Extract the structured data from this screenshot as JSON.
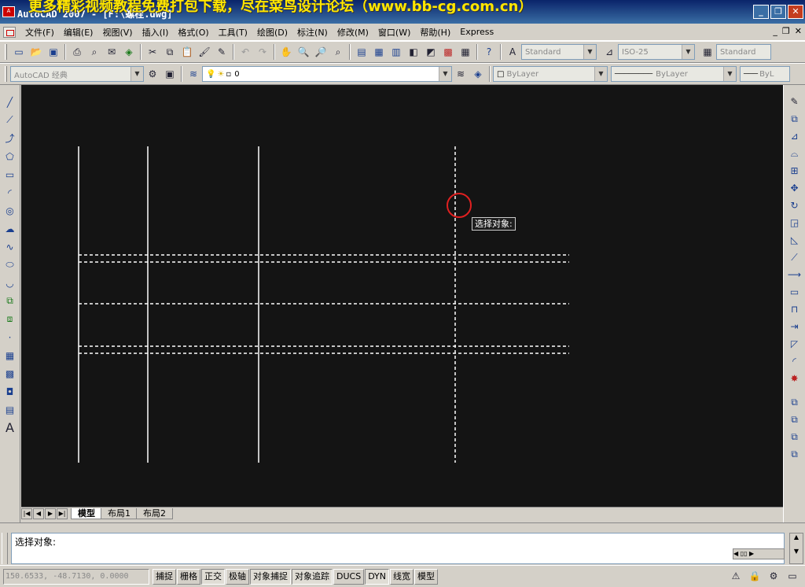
{
  "window": {
    "app_title": "AutoCAD 2007 - [F:\\螺栓.dwg]",
    "banner": "更多精彩视频教程免费打包下载，尽在菜鸟设计论坛（www.bb-cg.com.cn）",
    "app_icon": "A"
  },
  "menu": {
    "items": [
      "文件(F)",
      "编辑(E)",
      "视图(V)",
      "插入(I)",
      "格式(O)",
      "工具(T)",
      "绘图(D)",
      "标注(N)",
      "修改(M)",
      "窗口(W)",
      "帮助(H)",
      "Express"
    ]
  },
  "styles_toolbar": {
    "text_style": "Standard",
    "dim_style": "ISO-25",
    "table_style": "Standard"
  },
  "workspace_toolbar": {
    "workspace": "AutoCAD 经典",
    "layer": "0",
    "color": "ByLayer",
    "linetype": "ByLayer",
    "lineweight": "ByL"
  },
  "canvas": {
    "background": "#141414",
    "line_color": "#ffffff",
    "pickbox_color": "#e02020",
    "tooltip": "选择对象:"
  },
  "layout_tabs": [
    "模型",
    "布局1",
    "布局2"
  ],
  "command": {
    "prompt": "选择对象:"
  },
  "status": {
    "coords": "150.6533, -48.7130, 0.0000",
    "buttons": [
      {
        "label": "捕捉",
        "on": false
      },
      {
        "label": "栅格",
        "on": false
      },
      {
        "label": "正交",
        "on": true
      },
      {
        "label": "极轴",
        "on": false
      },
      {
        "label": "对象捕捉",
        "on": true
      },
      {
        "label": "对象追踪",
        "on": true
      },
      {
        "label": "DUCS",
        "on": false
      },
      {
        "label": "DYN",
        "on": true
      },
      {
        "label": "线宽",
        "on": false
      },
      {
        "label": "模型",
        "on": false
      }
    ]
  }
}
